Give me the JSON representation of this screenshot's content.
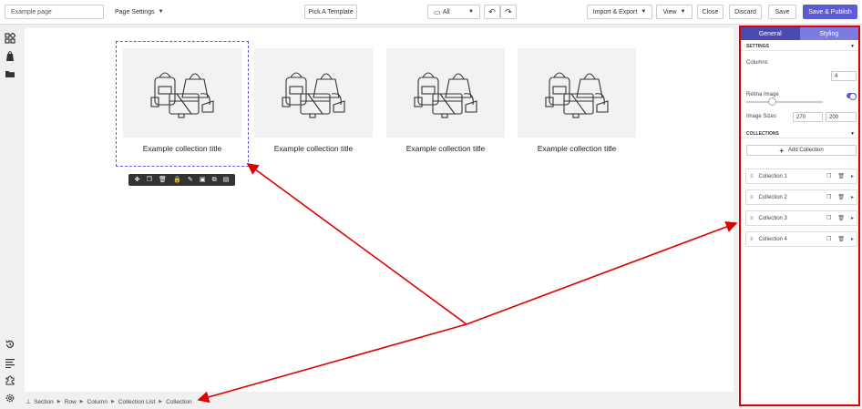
{
  "topbar": {
    "page_name": "Example page",
    "page_settings": "Page Settings",
    "pick_template": "Pick A Template",
    "device": "All",
    "import_export": "Import & Export",
    "view": "View",
    "close": "Close",
    "discard": "Discard",
    "save": "Save",
    "save_publish": "Save & Publish"
  },
  "collections": [
    {
      "title": "Example collection title"
    },
    {
      "title": "Example collection title"
    },
    {
      "title": "Example collection title"
    },
    {
      "title": "Example collection title"
    }
  ],
  "breadcrumb": [
    "Section",
    "Row",
    "Column",
    "Collection List",
    "Collection"
  ],
  "panel": {
    "tabs": [
      "General",
      "Styling"
    ],
    "settings_header": "SETTINGS",
    "columns_label": "Columns",
    "columns_value": "4",
    "retina_label": "Retina Image",
    "image_sizes_label": "Image Sizes",
    "image_width": "270",
    "image_height": "200",
    "collections_header": "COLLECTIONS",
    "add_collection": "Add Collection",
    "items": [
      "Collection 1",
      "Collection 2",
      "Collection 3",
      "Collection 4"
    ]
  },
  "accent_color": "#5b5bd6",
  "annotation_color": "#dd0000"
}
